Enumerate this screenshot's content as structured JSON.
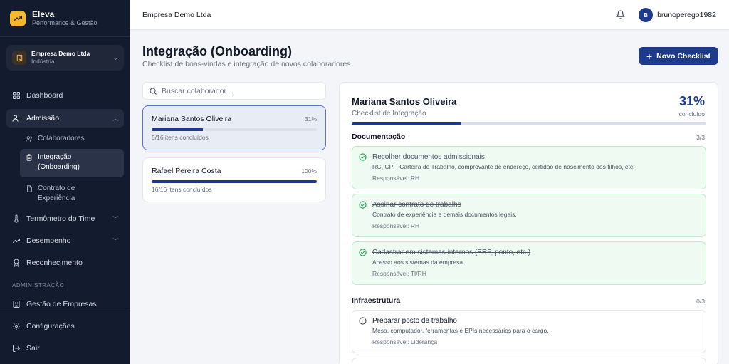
{
  "sidebar": {
    "brand": {
      "name": "Eleva",
      "subtitle": "Performance & Gestão"
    },
    "company": {
      "name": "Empresa Demo Ltda",
      "sector": "Indústria"
    },
    "nav": {
      "dashboard": "Dashboard",
      "admissao": "Admissão",
      "colaboradores": "Colaboradores",
      "integracao": "Integração (Onboarding)",
      "contrato": "Contrato de Experiência",
      "termometro": "Termômetro do Time",
      "desempenho": "Desempenho",
      "reconhecimento": "Reconhecimento",
      "admin_section": "ADMINISTRAÇÃO",
      "gestao_empresas": "Gestão de Empresas",
      "configuracoes": "Configurações",
      "sair": "Sair"
    }
  },
  "topbar": {
    "company": "Empresa Demo Ltda",
    "avatar_initial": "B",
    "username": "brunoperego1982"
  },
  "page": {
    "title": "Integração (Onboarding)",
    "subtitle": "Checklist de boas-vindas e integração de novos colaboradores",
    "new_button": "Novo Checklist"
  },
  "search": {
    "placeholder": "Buscar colaborador..."
  },
  "employees": [
    {
      "name": "Mariana Santos Oliveira",
      "percent": "31%",
      "progress": 0.31,
      "items": "5/16 itens concluídos"
    },
    {
      "name": "Rafael Pereira Costa",
      "percent": "100%",
      "progress": 1.0,
      "items": "16/16 itens concluídos"
    }
  ],
  "detail": {
    "name": "Mariana Santos Oliveira",
    "subtitle": "Checklist de Integração",
    "percent": "31%",
    "percent_label": "concluído",
    "progress": 0.31,
    "sections": [
      {
        "title": "Documentação",
        "count": "3/3",
        "tasks": [
          {
            "title": "Recolher documentos admissionais",
            "desc": "RG, CPF, Carteira de Trabalho, comprovante de endereço, certidão de nascimento dos filhos, etc.",
            "resp": "Responsável: RH"
          },
          {
            "title": "Assinar contrato de trabalho",
            "desc": "Contrato de experiência e demais documentos legais.",
            "resp": "Responsável: RH"
          },
          {
            "title": "Cadastrar em sistemas internos (ERP, ponto, etc.)",
            "desc": "Acesso aos sistemas da empresa.",
            "resp": "Responsável: TI/RH"
          }
        ]
      },
      {
        "title": "Infraestrutura",
        "count": "0/3",
        "tasks": [
          {
            "title": "Preparar posto de trabalho",
            "desc": "Mesa, computador, ferramentas e EPIs necessários para o cargo.",
            "resp": "Responsável: Liderança"
          }
        ]
      }
    ]
  },
  "colors": {
    "sidebar_bg": "#131b2e",
    "primary": "#1e3a8a",
    "brand": "#f5b92b",
    "done_bg": "#effaf2",
    "done_border": "#bfe9cb",
    "check": "#22a35a"
  }
}
